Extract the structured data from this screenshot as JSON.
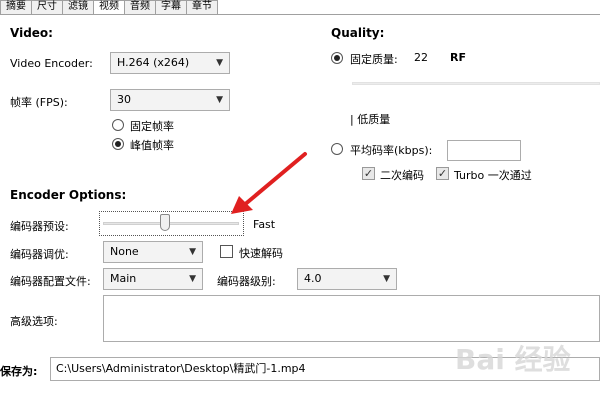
{
  "tabs": [
    "摘要",
    "尺寸",
    "滤镜",
    "视频",
    "音频",
    "字幕",
    "章节"
  ],
  "active_tab": "视频",
  "video": {
    "heading": "Video:",
    "encoder_label": "Video Encoder:",
    "encoder_value": "H.264 (x264)",
    "fps_label": "帧率 (FPS):",
    "fps_value": "30",
    "constant_fps": "固定帧率",
    "peak_fps": "峰值帧率"
  },
  "quality": {
    "heading": "Quality:",
    "constant_quality": "固定质量:",
    "quality_value": "22",
    "quality_unit": "RF",
    "low_quality": "| 低质量",
    "avg_bitrate": "平均码率(kbps):",
    "two_pass": "二次编码",
    "turbo": "Turbo 一次通过"
  },
  "encoder_options": {
    "heading": "Encoder Options:",
    "preset_label": "编码器预设:",
    "preset_value": "Fast",
    "preset_position": 0.45,
    "tune_label": "编码器调优:",
    "tune_value": "None",
    "fast_decode": "快速解码",
    "profile_label": "编码器配置文件:",
    "profile_value": "Main",
    "level_label": "编码器级别:",
    "level_value": "4.0",
    "advanced_label": "高级选项:"
  },
  "save": {
    "label": "保存为:",
    "path": "C:\\Users\\Administrator\\Desktop\\精武门-1.mp4"
  },
  "watermark": "Bai 经验",
  "colors": {
    "arrow": "#e02020"
  }
}
